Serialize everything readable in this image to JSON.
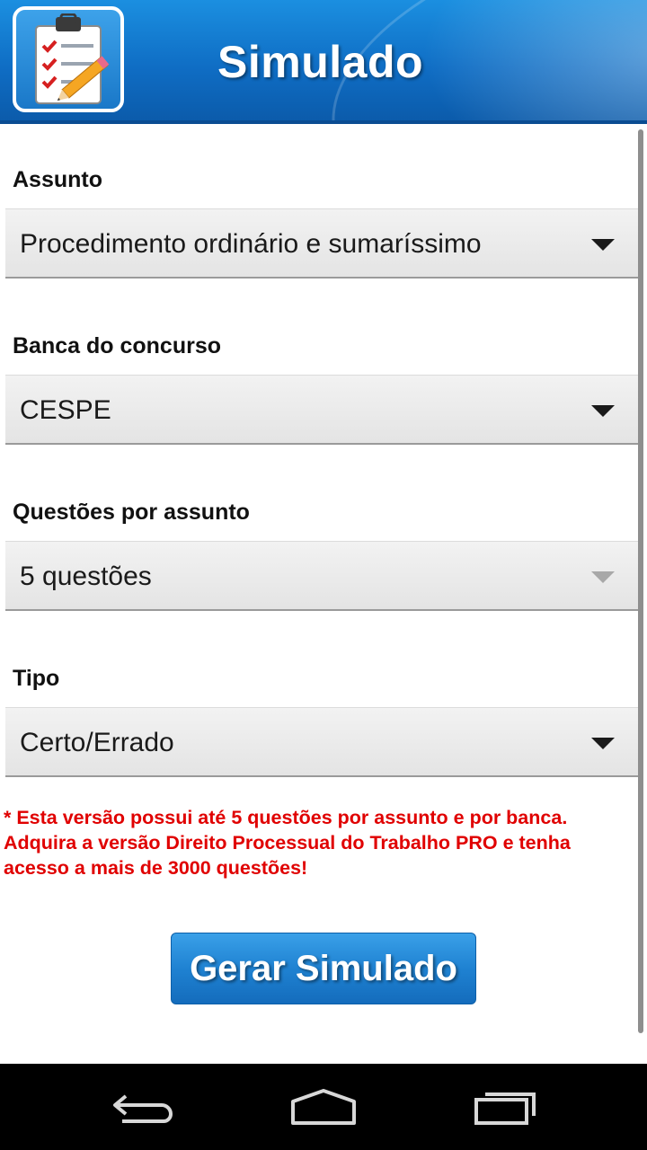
{
  "header": {
    "title": "Simulado",
    "icon": "clipboard-checklist-icon"
  },
  "form": {
    "fields": [
      {
        "label": "Assunto",
        "value": "Procedimento ordinário e sumaríssimo",
        "enabled": true
      },
      {
        "label": "Banca do concurso",
        "value": "CESPE",
        "enabled": true
      },
      {
        "label": "Questões por assunto",
        "value": "5 questões",
        "enabled": false
      },
      {
        "label": "Tipo",
        "value": "Certo/Errado",
        "enabled": true
      }
    ],
    "notice": "* Esta versão possui até 5 questões por assunto e por banca. Adquira a versão Direito Processual do Trabalho PRO e tenha acesso a mais de 3000 questões!",
    "submit_label": "Gerar Simulado"
  },
  "colors": {
    "header_blue": "#1b8fe0",
    "notice_red": "#e00000",
    "button_blue": "#1f82d2"
  },
  "navbar": {
    "back": "back-icon",
    "home": "home-icon",
    "recents": "recents-icon"
  }
}
